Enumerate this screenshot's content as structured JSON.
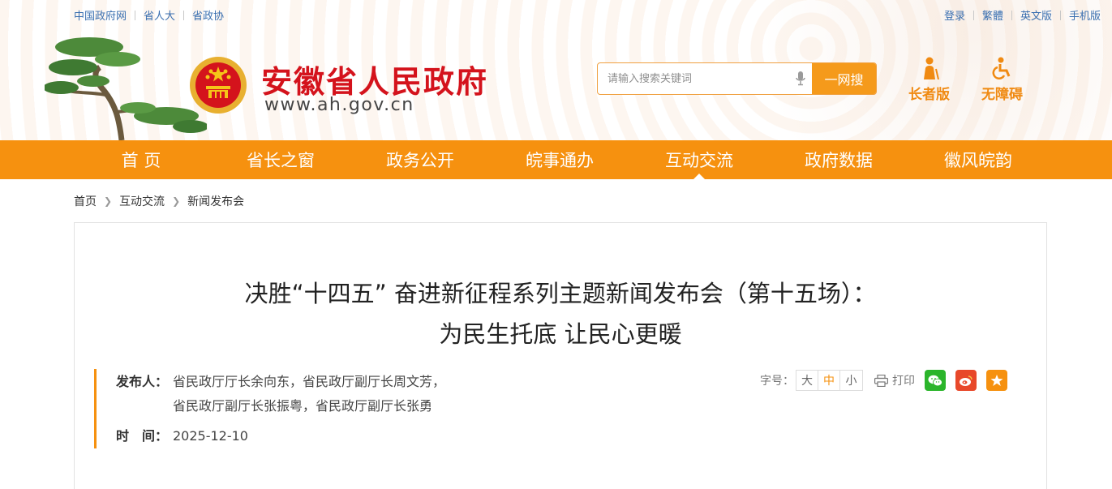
{
  "top_links_left": [
    "中国政府网",
    "省人大",
    "省政协"
  ],
  "top_links_right": [
    "登录",
    "繁體",
    "英文版",
    "手机版"
  ],
  "site": {
    "title": "安徽省人民政府",
    "url": "www.ah.gov.cn"
  },
  "search": {
    "placeholder": "请输入搜索关键词",
    "button": "一网搜"
  },
  "accessibility": {
    "elder": "长者版",
    "barrier_free": "无障碍"
  },
  "nav": [
    "首 页",
    "省长之窗",
    "政务公开",
    "皖事通办",
    "互动交流",
    "政府数据",
    "徽风皖韵"
  ],
  "nav_active": "互动交流",
  "breadcrumb": [
    "首页",
    "互动交流",
    "新闻发布会"
  ],
  "article": {
    "title_line1": "决胜“十四五” 奋进新征程系列主题新闻发布会（第十五场）：",
    "title_line2": "为民生托底 让民心更暖",
    "publisher_label": "发布人：",
    "publisher_line1": "省民政厅厅长余向东，省民政厅副厅长周文芳，",
    "publisher_line2": "省民政厅副厅长张振粤，省民政厅副厅长张勇",
    "time_label": "时　间：",
    "time": "2025-12-10"
  },
  "tools": {
    "font_label": "字号：",
    "font_sizes": [
      "大",
      "中",
      "小"
    ],
    "font_selected": "中",
    "print": "打印"
  },
  "colors": {
    "brand_orange": "#f6910f",
    "title_red": "#d4131c",
    "link_blue": "#3a6fb0"
  }
}
